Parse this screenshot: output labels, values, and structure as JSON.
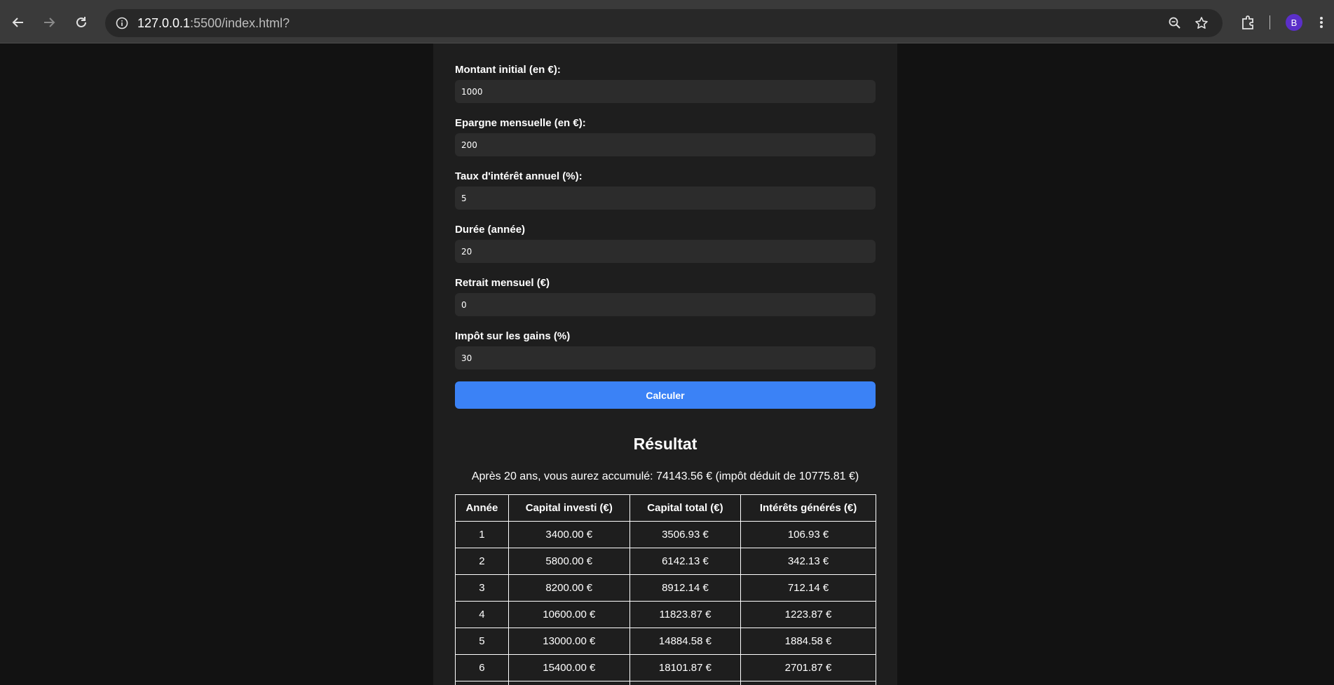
{
  "browser": {
    "url_host": "127.0.0.1",
    "url_rest": ":5500/index.html?",
    "avatar_letter": "B"
  },
  "form": {
    "fields": [
      {
        "label": "Montant initial (en €):",
        "value": "1000"
      },
      {
        "label": "Epargne mensuelle (en €):",
        "value": "200"
      },
      {
        "label": "Taux d'intérêt annuel (%):",
        "value": "5"
      },
      {
        "label": "Durée (année)",
        "value": "20"
      },
      {
        "label": "Retrait mensuel (€)",
        "value": "0"
      },
      {
        "label": "Impôt sur les gains (%)",
        "value": "30"
      }
    ],
    "submit_label": "Calculer"
  },
  "result": {
    "title": "Résultat",
    "summary": "Après 20 ans, vous aurez accumulé: 74143.56 € (impôt déduit de 10775.81 €)",
    "headers": [
      "Année",
      "Capital investi (€)",
      "Capital total (€)",
      "Intérêts générés (€)"
    ],
    "rows": [
      [
        "1",
        "3400.00 €",
        "3506.93 €",
        "106.93 €"
      ],
      [
        "2",
        "5800.00 €",
        "6142.13 €",
        "342.13 €"
      ],
      [
        "3",
        "8200.00 €",
        "8912.14 €",
        "712.14 €"
      ],
      [
        "4",
        "10600.00 €",
        "11823.87 €",
        "1223.87 €"
      ],
      [
        "5",
        "13000.00 €",
        "14884.58 €",
        "1884.58 €"
      ],
      [
        "6",
        "15400.00 €",
        "18101.87 €",
        "2701.87 €"
      ]
    ]
  },
  "colors": {
    "page_bg": "#121212",
    "panel_bg": "#1e1e1e",
    "input_bg": "#2c2c2c",
    "accent": "#3b82f6"
  }
}
